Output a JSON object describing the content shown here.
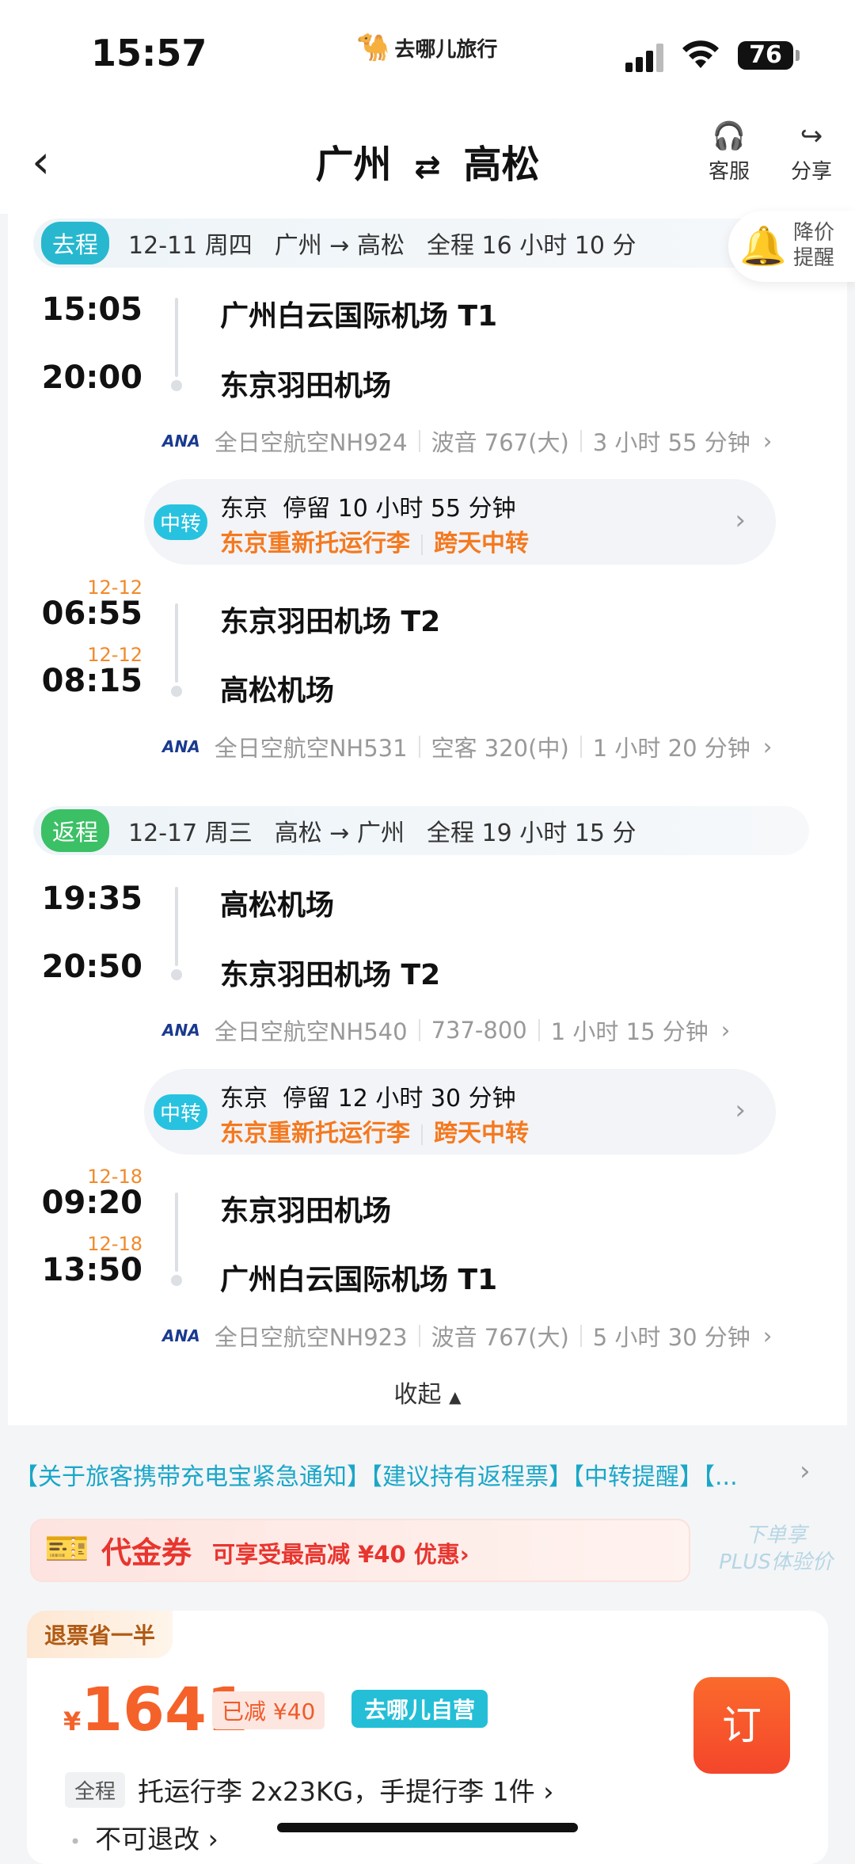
{
  "status": {
    "time": "15:57",
    "brand": "去哪儿旅行",
    "battery": "76"
  },
  "header": {
    "from": "广州",
    "to": "高松",
    "service": "客服",
    "share": "分享"
  },
  "alert": {
    "line1": "降价",
    "line2": "提醒"
  },
  "outbound": {
    "tag": "去程",
    "date": "12-11 周四",
    "route": "广州 → 高松",
    "total": "全程 16 小时 10 分",
    "leg1": {
      "dep_time": "15:05",
      "dep_airport": "广州白云国际机场 T1",
      "arr_time": "20:00",
      "arr_airport": "东京羽田机场",
      "airline": "全日空航空NH924",
      "aircraft": "波音 767(大)",
      "duration": "3 小时 55 分钟"
    },
    "transfer": {
      "tag": "中转",
      "city": "东京",
      "stay": "停留 10 小时 55 分钟",
      "note1": "东京重新托运行李",
      "note2": "跨天中转"
    },
    "leg2": {
      "dep_date": "12-12",
      "dep_time": "06:55",
      "dep_airport": "东京羽田机场 T2",
      "arr_date": "12-12",
      "arr_time": "08:15",
      "arr_airport": "高松机场",
      "airline": "全日空航空NH531",
      "aircraft": "空客 320(中)",
      "duration": "1 小时 20 分钟"
    }
  },
  "return": {
    "tag": "返程",
    "date": "12-17 周三",
    "route": "高松 → 广州",
    "total": "全程 19 小时 15 分",
    "leg1": {
      "dep_time": "19:35",
      "dep_airport": "高松机场",
      "arr_time": "20:50",
      "arr_airport": "东京羽田机场 T2",
      "airline": "全日空航空NH540",
      "aircraft": "737-800",
      "duration": "1 小时 15 分钟"
    },
    "transfer": {
      "tag": "中转",
      "city": "东京",
      "stay": "停留 12 小时 30 分钟",
      "note1": "东京重新托运行李",
      "note2": "跨天中转"
    },
    "leg2": {
      "dep_date": "12-18",
      "dep_time": "09:20",
      "dep_airport": "东京羽田机场",
      "arr_date": "12-18",
      "arr_time": "13:50",
      "arr_airport": "广州白云国际机场 T1",
      "airline": "全日空航空NH923",
      "aircraft": "波音 767(大)",
      "duration": "5 小时 30 分钟"
    }
  },
  "collapse_label": "收起",
  "notice": "【关于旅客携带充电宝紧急通知】【建议持有返程票】【中转提醒】【...",
  "coupon": {
    "title": "代金券",
    "desc": "可享受最高减 ¥40 优惠›"
  },
  "plus": {
    "line1": "下单享",
    "line2": "PLUS体验价"
  },
  "offer": {
    "badge": "退票省一半",
    "currency": "¥",
    "price": "1641",
    "discount": "已减 ¥40",
    "self_label": "去哪儿自营",
    "book": "订",
    "scope": "全程",
    "baggage": "托运行李 2x23KG，手提行李 1件 ›",
    "refund": "不可退改 ›"
  }
}
